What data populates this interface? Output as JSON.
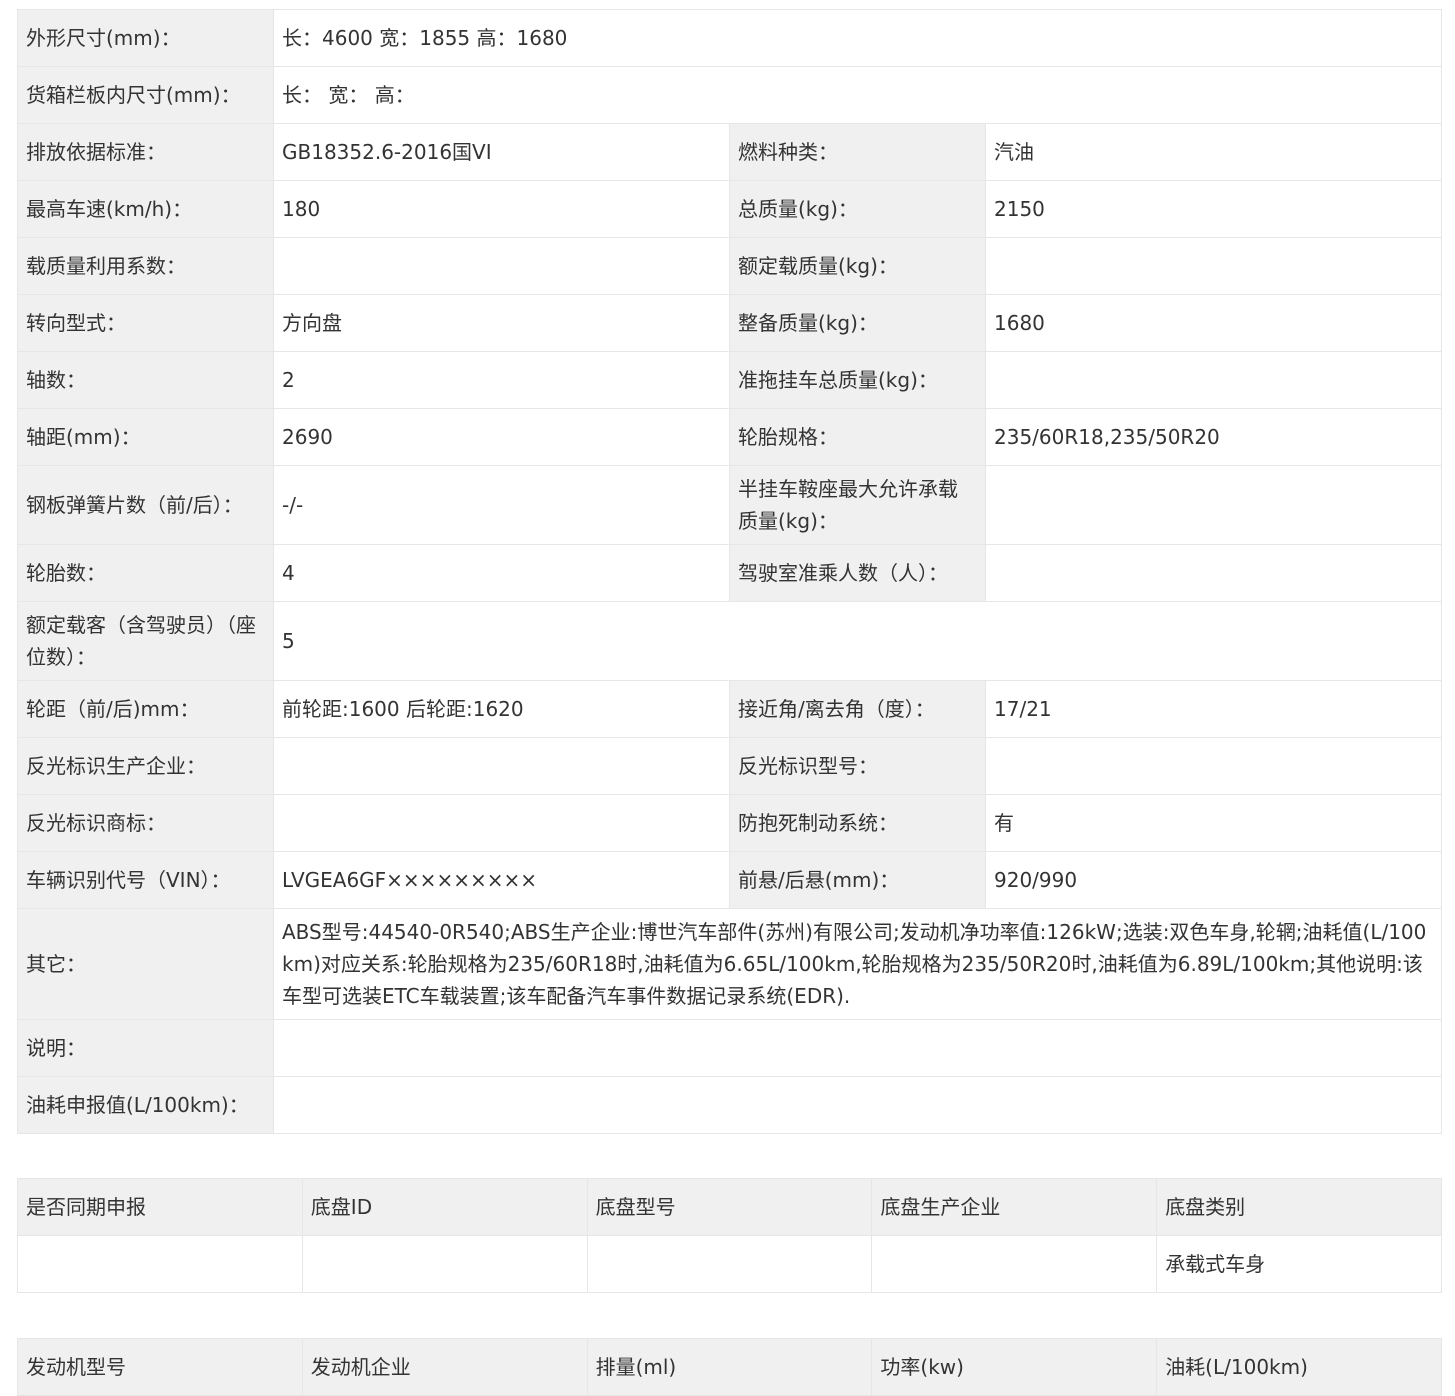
{
  "spec": {
    "dimensions_label": "外形尺寸(mm)：",
    "dimensions_value": "长：4600 宽：1855 高：1680",
    "cargo_label": "货箱栏板内尺寸(mm)：",
    "cargo_value": "长： 宽： 高：",
    "emission_label": "排放依据标准：",
    "emission_value": "GB18352.6-2016国VI",
    "fuel_label": "燃料种类：",
    "fuel_value": "汽油",
    "speed_label": "最高车速(km/h)：",
    "speed_value": "180",
    "gross_mass_label": "总质量(kg)：",
    "gross_mass_value": "2150",
    "load_coef_label": "载质量利用系数：",
    "load_coef_value": "",
    "rated_load_label": "额定载质量(kg)：",
    "rated_load_value": "",
    "steering_label": "转向型式：",
    "steering_value": "方向盘",
    "curb_mass_label": "整备质量(kg)：",
    "curb_mass_value": "1680",
    "axles_label": "轴数：",
    "axles_value": "2",
    "trailer_label": "准拖挂车总质量(kg)：",
    "trailer_value": "",
    "wheelbase_label": "轴距(mm)：",
    "wheelbase_value": "2690",
    "tire_spec_label": "轮胎规格：",
    "tire_spec_value": "235/60R18,235/50R20",
    "spring_label": "钢板弹簧片数（前/后）：",
    "spring_value": "-/-",
    "saddle_label": "半挂车鞍座最大允许承载质量(kg)：",
    "saddle_value": "",
    "tires_label": "轮胎数：",
    "tires_value": "4",
    "cab_label": "驾驶室准乘人数（人）：",
    "cab_value": "",
    "seats_label": "额定载客（含驾驶员）（座位数）：",
    "seats_value": "5",
    "track_label": "轮距（前/后)mm：",
    "track_value": "前轮距:1600 后轮距:1620",
    "angle_label": "接近角/离去角（度）：",
    "angle_value": "17/21",
    "reflect_maker_label": "反光标识生产企业：",
    "reflect_maker_value": "",
    "reflect_model_label": "反光标识型号：",
    "reflect_model_value": "",
    "reflect_brand_label": "反光标识商标：",
    "reflect_brand_value": "",
    "abs_label": "防抱死制动系统：",
    "abs_value": "有",
    "vin_label": "车辆识别代号（VIN）：",
    "vin_value": "LVGEA6GF×××××××××",
    "overhang_label": "前悬/后悬(mm)：",
    "overhang_value": "920/990",
    "other_label": "其它：",
    "other_value": "ABS型号:44540-0R540;ABS生产企业:博世汽车部件(苏州)有限公司;发动机净功率值:126kW;选装:双色车身,轮辋;油耗值(L/100km)对应关系:轮胎规格为235/60R18时,油耗值为6.65L/100km,轮胎规格为235/50R20时,油耗值为6.89L/100km;其他说明:该车型可选装ETC车载装置;该车配备汽车事件数据记录系统(EDR).",
    "note_label": "说明：",
    "note_value": "",
    "fuel_decl_label": "油耗申报值(L/100km)：",
    "fuel_decl_value": ""
  },
  "chassis": {
    "headers": [
      "是否同期申报",
      "底盘ID",
      "底盘型号",
      "底盘生产企业",
      "底盘类别"
    ],
    "row": [
      "",
      "",
      "",
      "",
      "承载式车身"
    ]
  },
  "engine": {
    "headers": [
      "发动机型号",
      "发动机企业",
      "排量(ml)",
      "功率(kw)",
      "油耗(L/100km)"
    ]
  }
}
